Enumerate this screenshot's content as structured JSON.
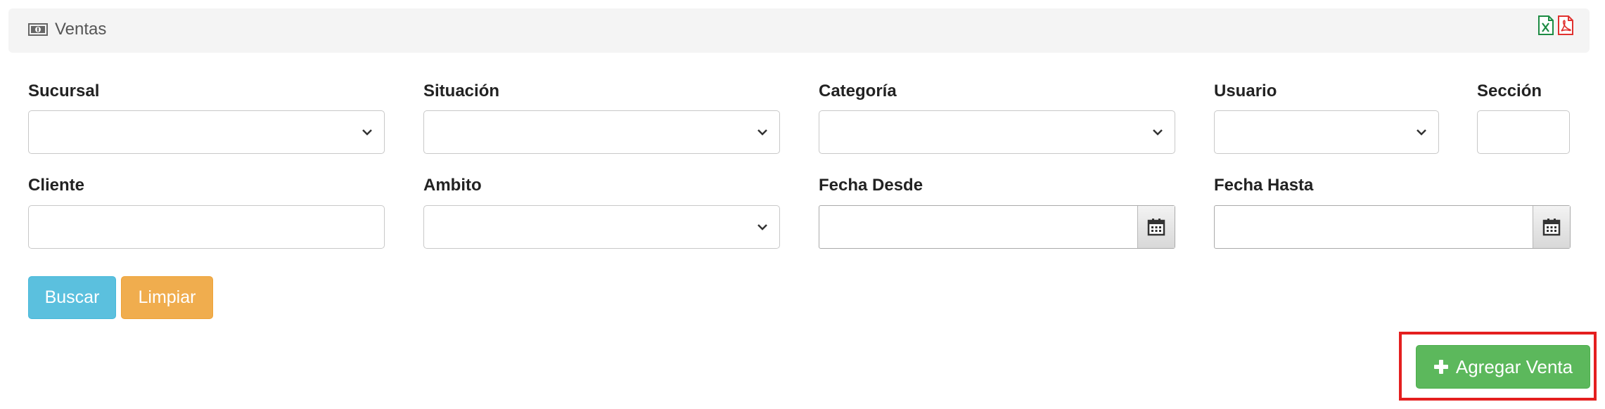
{
  "header": {
    "title": "Ventas",
    "title_icon": "money-icon",
    "export_icons": [
      "excel-file-icon",
      "pdf-file-icon"
    ]
  },
  "filters": {
    "sucursal": {
      "label": "Sucursal",
      "value": ""
    },
    "situacion": {
      "label": "Situación",
      "value": ""
    },
    "categoria": {
      "label": "Categoría",
      "value": ""
    },
    "usuario": {
      "label": "Usuario",
      "value": ""
    },
    "seccion": {
      "label": "Sección",
      "value": ""
    },
    "cliente": {
      "label": "Cliente",
      "value": ""
    },
    "ambito": {
      "label": "Ambito",
      "value": ""
    },
    "fecha_desde": {
      "label": "Fecha Desde",
      "value": ""
    },
    "fecha_hasta": {
      "label": "Fecha Hasta",
      "value": ""
    }
  },
  "actions": {
    "buscar": "Buscar",
    "limpiar": "Limpiar",
    "agregar": "Agregar Venta"
  },
  "colors": {
    "buscar": "#5bc0de",
    "limpiar": "#f0ad4e",
    "agregar": "#5cb85c",
    "highlight": "#e41f1f",
    "excel": "#1d8b43",
    "pdf": "#e0312f"
  }
}
